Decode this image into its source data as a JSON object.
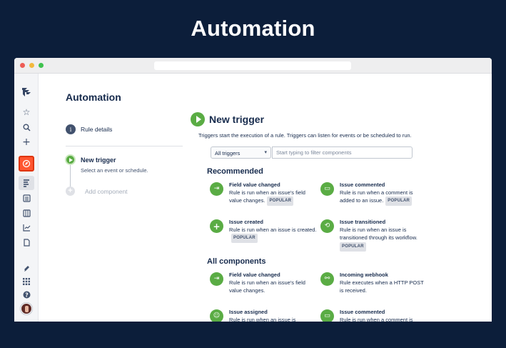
{
  "hero": {
    "title": "Automation"
  },
  "page": {
    "title": "Automation",
    "rule_details": "Rule details",
    "step": {
      "title": "New trigger",
      "subtitle": "Select an event or schedule."
    },
    "add_component": "Add component"
  },
  "main": {
    "title": "New trigger",
    "description": "Triggers start the execution of a rule. Triggers can listen for events or be scheduled to run.",
    "dropdown": {
      "value": "All triggers"
    },
    "filter": {
      "placeholder": "Start typing to filter components"
    },
    "recommended": {
      "heading": "Recommended",
      "items": [
        {
          "title": "Field value changed",
          "desc": "Rule is run when an issue's field value changes.",
          "badge": "POPULAR",
          "icon": "field-change-icon"
        },
        {
          "title": "Issue commented",
          "desc": "Rule is run when a comment is added to an issue.",
          "badge": "POPULAR",
          "icon": "comment-icon"
        },
        {
          "title": "Issue created",
          "desc": "Rule is run when an issue is created.",
          "badge": "POPULAR",
          "icon": "plus-icon"
        },
        {
          "title": "Issue transitioned",
          "desc": "Rule is run when an issue is transitioned through its workflow.",
          "badge": "POPULAR",
          "icon": "transition-icon"
        }
      ]
    },
    "all": {
      "heading": "All components",
      "items": [
        {
          "title": "Field value changed",
          "desc": "Rule is run when an issue's field value changes.",
          "icon": "field-change-icon"
        },
        {
          "title": "Incoming webhook",
          "desc": "Rule executes when a HTTP POST is received.",
          "icon": "webhook-icon"
        },
        {
          "title": "Issue assigned",
          "desc": "Rule is run when an issue is",
          "icon": "assign-icon"
        },
        {
          "title": "Issue commented",
          "desc": "Rule is run when a comment is",
          "icon": "comment-icon"
        }
      ]
    }
  },
  "colors": {
    "background": "#0c1e3a",
    "accent_green": "#5aac44",
    "active_red": "#ff5630"
  }
}
